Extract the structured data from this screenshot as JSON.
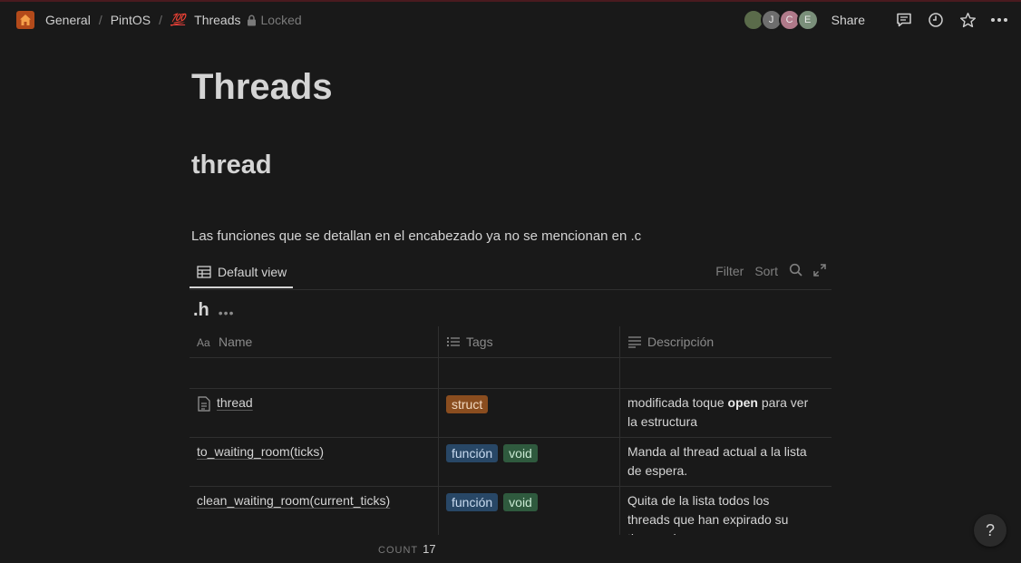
{
  "breadcrumb": {
    "items": [
      {
        "label": "General",
        "icon": "home-icon"
      },
      {
        "label": "PintOS"
      },
      {
        "label": "Threads",
        "icon": "hundred-points-icon",
        "icon_text": "💯"
      }
    ],
    "locked_label": "Locked"
  },
  "topbar": {
    "avatars": [
      {
        "initial": "",
        "color": "#5a6b4a"
      },
      {
        "initial": "J",
        "color": "#6e6e6e"
      },
      {
        "initial": "C",
        "color": "#b07a8a"
      },
      {
        "initial": "E",
        "color": "#7a8f7a"
      }
    ],
    "share_label": "Share"
  },
  "page": {
    "title": "Threads",
    "heading": "thread",
    "paragraph": "Las funciones que se detallan en el encabezado ya no se mencionan en .c"
  },
  "database": {
    "view_label": "Default view",
    "filter_label": "Filter",
    "sort_label": "Sort",
    "group_title": ".h",
    "group_more": "•••",
    "columns": [
      {
        "label": "Name",
        "icon": "text-type-icon"
      },
      {
        "label": "Tags",
        "icon": "list-icon"
      },
      {
        "label": "Descripción",
        "icon": "text-lines-icon"
      }
    ],
    "rows": [
      {
        "name": "",
        "tags": [],
        "desc_pre": "",
        "desc_bold": "",
        "desc_post": ""
      },
      {
        "name": "thread",
        "has_page_icon": true,
        "tags": [
          {
            "label": "struct",
            "bg": "#8a4d1f",
            "fg": "#f2d8c0"
          }
        ],
        "desc_pre": "modificada toque ",
        "desc_bold": "open",
        "desc_post": " para ver la estructura"
      },
      {
        "name": "to_waiting_room(ticks)",
        "tags": [
          {
            "label": "función",
            "bg": "#284766",
            "fg": "#c9dbf0"
          },
          {
            "label": "void",
            "bg": "#2f5a3e",
            "fg": "#c8e8d2"
          }
        ],
        "desc_pre": "Manda al thread actual a la lista de espera.",
        "desc_bold": "",
        "desc_post": ""
      },
      {
        "name": "clean_waiting_room(current_ticks)",
        "tags": [
          {
            "label": "función",
            "bg": "#284766",
            "fg": "#c9dbf0"
          },
          {
            "label": "void",
            "bg": "#2f5a3e",
            "fg": "#c8e8d2"
          }
        ],
        "desc_pre": "Quita de la lista todos los threads que han expirado su tiempo de espera.",
        "desc_bold": "",
        "desc_post": ""
      }
    ],
    "count_label": "COUNT",
    "count_value": "17"
  },
  "help_label": "?"
}
